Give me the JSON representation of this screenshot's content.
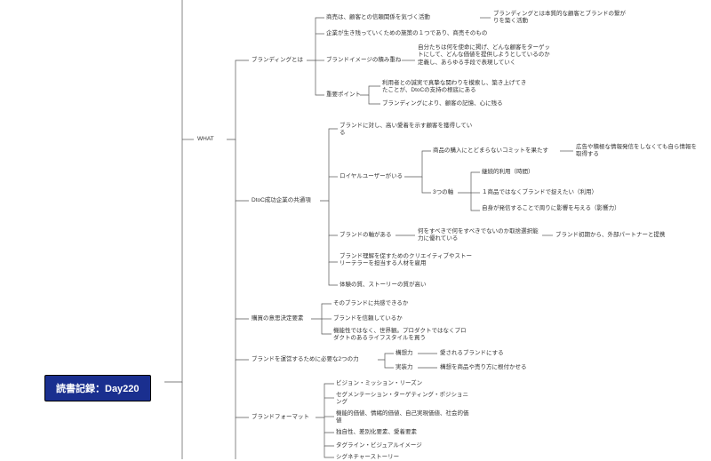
{
  "root": {
    "label": "読書記録：Day220"
  },
  "section": {
    "label": "WHAT"
  },
  "branding": {
    "label": "ブランディングとは",
    "n1": "商売は、顧客との信頼関係を気づく活動",
    "n1_sub": "ブランディングとは本質的な顧客とブランドの繋がりを築く活動",
    "n2": "企業が生き残っていくための施策の１つであり、商売そのもの",
    "n3": "ブランドイメージの積み重ね",
    "n3_sub": "自分たちは何を使命に掲げ、どんな顧客をターゲットにして、どんな価値を提供しようとしているのか定義し、あらゆる手段で表現していく",
    "n4": "重要ポイント",
    "n4_sub1": "利用者との誠実で真摯な関わりを模索し、築き上げてきたことが、DtoCの支持の根底にある",
    "n4_sub2": "ブランディングにより、顧客の記憶、心に残る"
  },
  "dtoc": {
    "label": "DtoC成功企業の共通項",
    "n1": "ブランドに対し、高い愛着を示す顧客を獲得している",
    "loyal": {
      "label": "ロイヤルユーザーがいる",
      "c1": "商品の購入にとどまらないコミットを果たす",
      "c1_sub": "広告や積極な情報発信をしなくても自ら情報を取得する",
      "axes": {
        "label": "3つの軸",
        "a1": "継続的利用（時間）",
        "a2": "１商品ではなくブランドで捉えたい（利用）",
        "a3": "自身が発信することで周りに影響を与える（影響力）"
      }
    },
    "axis": {
      "label": "ブランドの軸がある",
      "sub": "何をすべきで何をすべきでないのか取捨選択能力に優れている",
      "sub2": "ブランド初期から、外部パートナーと提携"
    },
    "talent": "ブランド理解を促すためのクリエイティブやストーリーテラーを担当する人材を雇用",
    "quality": "体験の質、ストーリーの質が高い"
  },
  "purchase": {
    "label": "購買の意思決定要素",
    "n1": "そのブランドに共感できるか",
    "n2": "ブランドを信頼しているか",
    "n3": "機能性ではなく、世界観。プロダクトではなくプロダクトのあるライフスタイルを買う"
  },
  "forces": {
    "label": "ブランドを運営するために必要な2つの力",
    "n1": "構想力",
    "n1_sub": "愛されるブランドにする",
    "n2": "実装力",
    "n2_sub": "構想を商品や売り方に根付かせる"
  },
  "format": {
    "label": "ブランドフォーマット",
    "n1": "ビジョン・ミッション・リーズン",
    "n2": "セグメンテーション・ターゲティング・ポジショニング",
    "n3": "機能的価値、情緒的価値、自己実現価値、社会的価値",
    "n4": "独自性、差別化要素、愛着要素",
    "n5": "タグライン・ビジュアルイメージ",
    "n6": "シグネチャーストーリー"
  },
  "chart_data": {
    "type": "mindmap",
    "root": "読書記録：Day220",
    "children": [
      {
        "label": "WHAT",
        "children": [
          {
            "label": "ブランディングとは",
            "children": [
              {
                "label": "商売は、顧客との信頼関係を気づく活動",
                "children": [
                  {
                    "label": "ブランディングとは本質的な顧客とブランドの繋がりを築く活動"
                  }
                ]
              },
              {
                "label": "企業が生き残っていくための施策の１つであり、商売そのもの"
              },
              {
                "label": "ブランドイメージの積み重ね",
                "children": [
                  {
                    "label": "自分たちは何を使命に掲げ、どんな顧客をターゲットにして、どんな価値を提供しようとしているのか定義し、あらゆる手段で表現していく"
                  }
                ]
              },
              {
                "label": "重要ポイント",
                "children": [
                  {
                    "label": "利用者との誠実で真摯な関わりを模索し、築き上げてきたことが、DtoCの支持の根底にある"
                  },
                  {
                    "label": "ブランディングにより、顧客の記憶、心に残る"
                  }
                ]
              }
            ]
          },
          {
            "label": "DtoC成功企業の共通項",
            "children": [
              {
                "label": "ブランドに対し、高い愛着を示す顧客を獲得している"
              },
              {
                "label": "ロイヤルユーザーがいる",
                "children": [
                  {
                    "label": "商品の購入にとどまらないコミットを果たす",
                    "children": [
                      {
                        "label": "広告や積極な情報発信をしなくても自ら情報を取得する"
                      }
                    ]
                  },
                  {
                    "label": "3つの軸",
                    "children": [
                      {
                        "label": "継続的利用（時間）"
                      },
                      {
                        "label": "１商品ではなくブランドで捉えたい（利用）"
                      },
                      {
                        "label": "自身が発信することで周りに影響を与える（影響力）"
                      }
                    ]
                  }
                ]
              },
              {
                "label": "ブランドの軸がある",
                "children": [
                  {
                    "label": "何をすべきで何をすべきでないのか取捨選択能力に優れている",
                    "children": [
                      {
                        "label": "ブランド初期から、外部パートナーと提携"
                      }
                    ]
                  }
                ]
              },
              {
                "label": "ブランド理解を促すためのクリエイティブやストーリーテラーを担当する人材を雇用"
              },
              {
                "label": "体験の質、ストーリーの質が高い"
              }
            ]
          },
          {
            "label": "購買の意思決定要素",
            "children": [
              {
                "label": "そのブランドに共感できるか"
              },
              {
                "label": "ブランドを信頼しているか"
              },
              {
                "label": "機能性ではなく、世界観。プロダクトではなくプロダクトのあるライフスタイルを買う"
              }
            ]
          },
          {
            "label": "ブランドを運営するために必要な2つの力",
            "children": [
              {
                "label": "構想力",
                "children": [
                  {
                    "label": "愛されるブランドにする"
                  }
                ]
              },
              {
                "label": "実装力",
                "children": [
                  {
                    "label": "構想を商品や売り方に根付かせる"
                  }
                ]
              }
            ]
          },
          {
            "label": "ブランドフォーマット",
            "children": [
              {
                "label": "ビジョン・ミッション・リーズン"
              },
              {
                "label": "セグメンテーション・ターゲティング・ポジショニング"
              },
              {
                "label": "機能的価値、情緒的価値、自己実現価値、社会的価値"
              },
              {
                "label": "独自性、差別化要素、愛着要素"
              },
              {
                "label": "タグライン・ビジュアルイメージ"
              },
              {
                "label": "シグネチャーストーリー"
              }
            ]
          }
        ]
      }
    ]
  }
}
